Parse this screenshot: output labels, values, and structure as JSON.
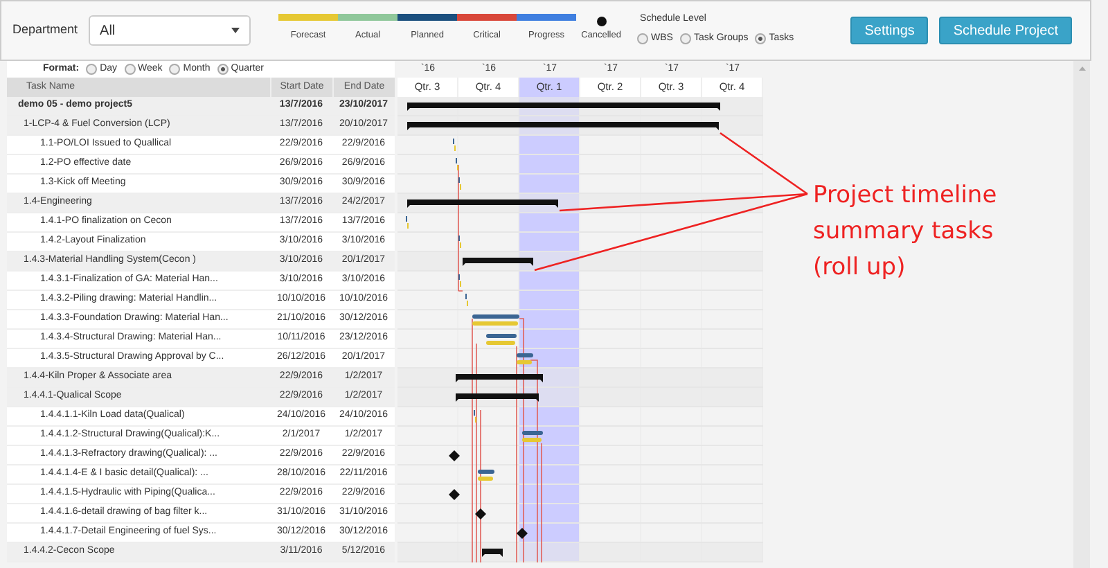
{
  "department": {
    "label": "Department",
    "value": "All"
  },
  "legend": [
    {
      "label": "Forecast",
      "color": "#e6c833",
      "kind": "bar"
    },
    {
      "label": "Actual",
      "color": "#8fc79a",
      "kind": "bar"
    },
    {
      "label": "Planned",
      "color": "#1b4f7e",
      "kind": "bar"
    },
    {
      "label": "Critical",
      "color": "#d9473a",
      "kind": "bar"
    },
    {
      "label": "Progress",
      "color": "#3f7fe0",
      "kind": "bar"
    },
    {
      "label": "Cancelled",
      "color": "#111111",
      "kind": "dot"
    }
  ],
  "schedule_level": {
    "title": "Schedule Level",
    "options": [
      {
        "label": "WBS",
        "selected": false
      },
      {
        "label": "Task Groups",
        "selected": false
      },
      {
        "label": "Tasks",
        "selected": true
      }
    ]
  },
  "buttons": [
    "Settings",
    "Schedule Project"
  ],
  "format": {
    "label": "Format:",
    "options": [
      {
        "label": "Day",
        "selected": false
      },
      {
        "label": "Week",
        "selected": false
      },
      {
        "label": "Month",
        "selected": false
      },
      {
        "label": "Quarter",
        "selected": true
      }
    ]
  },
  "columns": [
    "Task Name",
    "Start Date",
    "End Date"
  ],
  "timeline": [
    {
      "year": "`16",
      "quarter": "Qtr. 3",
      "highlighted": false
    },
    {
      "year": "`16",
      "quarter": "Qtr. 4",
      "highlighted": false
    },
    {
      "year": "`17",
      "quarter": "Qtr. 1",
      "highlighted": true
    },
    {
      "year": "`17",
      "quarter": "Qtr. 2",
      "highlighted": false
    },
    {
      "year": "`17",
      "quarter": "Qtr. 3",
      "highlighted": false
    },
    {
      "year": "`17",
      "quarter": "Qtr. 4",
      "highlighted": false
    }
  ],
  "tasks": {
    "name": "demo 05 - demo project5",
    "start": "13/7/2016",
    "end": "23/10/2017",
    "children": [
      {
        "name": "1-LCP-4 & Fuel Conversion (LCP)",
        "start": "13/7/2016",
        "end": "20/10/2017",
        "children": [
          {
            "name": "1.1-PO/LOI Issued to Quallical",
            "start": "22/9/2016",
            "end": "22/9/2016"
          },
          {
            "name": "1.2-PO effective date",
            "start": "26/9/2016",
            "end": "26/9/2016"
          },
          {
            "name": "1.3-Kick off Meeting",
            "start": "30/9/2016",
            "end": "30/9/2016"
          }
        ]
      },
      {
        "name": "1.4-Engineering",
        "start": "13/7/2016",
        "end": "24/2/2017",
        "children": [
          {
            "name": "1.4.1-PO finalization on Cecon",
            "start": "13/7/2016",
            "end": "13/7/2016"
          },
          {
            "name": "1.4.2-Layout Finalization",
            "start": "3/10/2016",
            "end": "3/10/2016"
          }
        ]
      },
      {
        "name": "1.4.3-Material Handling System(Cecon )",
        "start": "3/10/2016",
        "end": "20/1/2017",
        "children": [
          {
            "name": "1.4.3.1-Finalization of GA: Material Han...",
            "start": "3/10/2016",
            "end": "3/10/2016"
          },
          {
            "name": "1.4.3.2-Piling drawing: Material Handlin...",
            "start": "10/10/2016",
            "end": "10/10/2016"
          },
          {
            "name": "1.4.3.3-Foundation Drawing: Material Han...",
            "start": "21/10/2016",
            "end": "30/12/2016"
          },
          {
            "name": "1.4.3.4-Structural Drawing: Material Han...",
            "start": "10/11/2016",
            "end": "23/12/2016"
          },
          {
            "name": "1.4.3.5-Structural Drawing Approval by C...",
            "start": "26/12/2016",
            "end": "20/1/2017"
          }
        ]
      },
      {
        "name": "1.4.4-Kiln Proper & Associate area",
        "start": "22/9/2016",
        "end": "1/2/2017"
      },
      {
        "name": "1.4.4.1-Qualical Scope",
        "start": "22/9/2016",
        "end": "1/2/2017",
        "children": [
          {
            "name": "1.4.4.1.1-Kiln Load data(Qualical)",
            "start": "24/10/2016",
            "end": "24/10/2016"
          },
          {
            "name": "1.4.4.1.2-Structural Drawing(Qualical):K...",
            "start": "2/1/2017",
            "end": "1/2/2017"
          },
          {
            "name": "1.4.4.1.3-Refractory drawing(Qualical): ...",
            "start": "22/9/2016",
            "end": "22/9/2016"
          },
          {
            "name": "1.4.4.1.4-E & I basic detail(Qualical): ...",
            "start": "28/10/2016",
            "end": "22/11/2016"
          },
          {
            "name": "1.4.4.1.5-Hydraulic with Piping(Qualica...",
            "start": "22/9/2016",
            "end": "22/9/2016"
          },
          {
            "name": "1.4.4.1.6-detail drawing of bag filter k...",
            "start": "31/10/2016",
            "end": "31/10/2016"
          },
          {
            "name": "1.4.4.1.7-Detail Engineering of fuel Sys...",
            "start": "30/12/2016",
            "end": "30/12/2016"
          }
        ]
      },
      {
        "name": "1.4.4.2-Cecon Scope",
        "start": "3/11/2016",
        "end": "5/12/2016"
      }
    ]
  },
  "annotation": [
    "Project timeline",
    "summary tasks",
    "(roll up)"
  ]
}
